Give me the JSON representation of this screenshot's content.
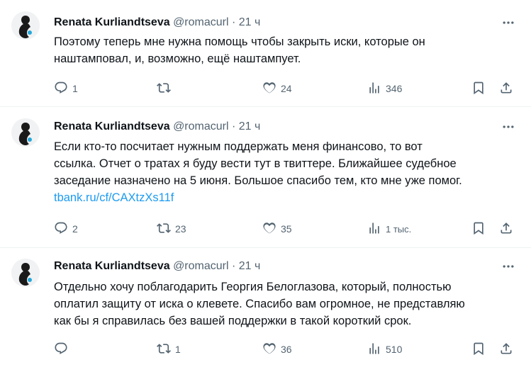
{
  "tweets": [
    {
      "name": "Renata Kurliandtseva",
      "handle": "@romacurl",
      "dot": "·",
      "time": "21 ч",
      "text": "Поэтому теперь мне нужна помощь чтобы закрыть иски, которые он\nнаштамповал, и, возможно, ещё наштампует.",
      "link": "",
      "replies": "1",
      "retweets": "",
      "likes": "24",
      "views": "346"
    },
    {
      "name": "Renata Kurliandtseva",
      "handle": "@romacurl",
      "dot": "·",
      "time": "21 ч",
      "text": "Если кто-то посчитает нужным поддержать меня финансово, то вот\nссылка. Отчет о тратах я буду вести тут в твиттере. Ближайшее судебное\nзаседание назначено на 5 июня. Большое спасибо тем, кто мне уже помог.",
      "link": "tbank.ru/cf/CAXtzXs11f",
      "replies": "2",
      "retweets": "23",
      "likes": "35",
      "views": "1 тыс."
    },
    {
      "name": "Renata Kurliandtseva",
      "handle": "@romacurl",
      "dot": "·",
      "time": "21 ч",
      "text": "Отдельно хочу поблагодарить Георгия Белоглазова, который, полностью\nоплатил защиту от иска о клевете. Спасибо вам огромное, не представляю\nкак бы я справилась без вашей поддержки в такой короткий срок.",
      "link": "",
      "replies": "",
      "retweets": "1",
      "likes": "36",
      "views": "510"
    }
  ],
  "icons": {
    "reply": "reply-icon",
    "retweet": "retweet-icon",
    "like": "heart-icon",
    "views": "views-icon",
    "bookmark": "bookmark-icon",
    "share": "share-icon",
    "more": "more-icon"
  },
  "colors": {
    "text": "#0f1419",
    "secondary": "#536471",
    "link": "#1d9bf0",
    "divider": "#eff3f4"
  }
}
